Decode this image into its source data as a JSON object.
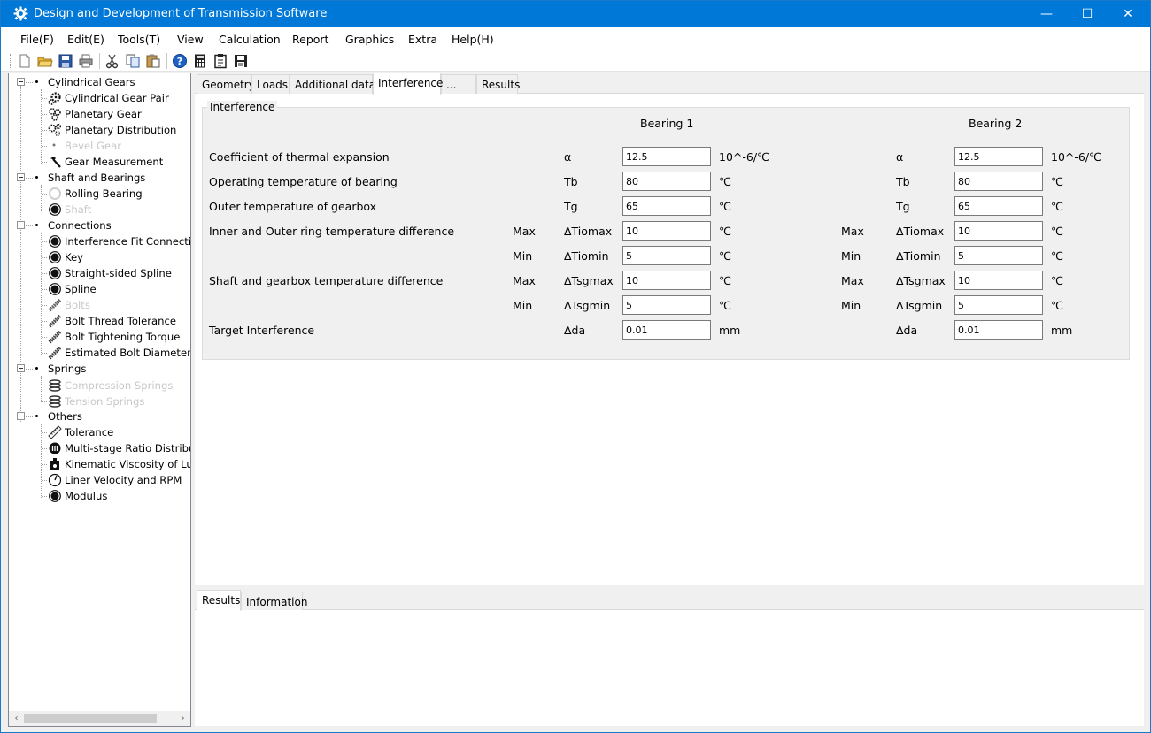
{
  "window": {
    "title": "Design and Development of Transmission Software",
    "minimize_glyph": "—",
    "maximize_glyph": "☐",
    "close_glyph": "✕",
    "app_icon": "gear-icon"
  },
  "menu": [
    {
      "label": "File(F)"
    },
    {
      "label": "Edit(E)"
    },
    {
      "label": "Tools(T)"
    },
    {
      "label": "View"
    },
    {
      "label": "Calculation"
    },
    {
      "label": "Report"
    },
    {
      "label": "Graphics"
    },
    {
      "label": "Extra"
    },
    {
      "label": "Help(H)"
    }
  ],
  "toolbar": [
    "new-file-icon",
    "open-folder-icon",
    "save-icon",
    "print-icon",
    "cut-icon",
    "copy-icon",
    "paste-icon",
    "help-icon",
    "calculator-icon",
    "clipboard-icon",
    "save-as-icon"
  ],
  "tree": {
    "groups": [
      {
        "label": "Cylindrical Gears",
        "children": [
          {
            "label": "Cylindrical Gear Pair",
            "icon": "gear-icon",
            "enabled": true
          },
          {
            "label": "Planetary Gear",
            "icon": "planetary-gear-icon",
            "enabled": true
          },
          {
            "label": "Planetary Distribution",
            "icon": "planetary-distribution-icon",
            "enabled": true
          },
          {
            "label": "Bevel Gear",
            "icon": "dot-icon",
            "enabled": false
          },
          {
            "label": "Gear Measurement",
            "icon": "hammer-icon",
            "enabled": true
          }
        ]
      },
      {
        "label": "Shaft and Bearings",
        "children": [
          {
            "label": "Rolling Bearing",
            "icon": "ring-icon",
            "enabled": true
          },
          {
            "label": "Shaft",
            "icon": "disc-icon",
            "enabled": false
          }
        ]
      },
      {
        "label": "Connections",
        "children": [
          {
            "label": "Interference Fit Connection",
            "icon": "disc-icon",
            "enabled": true
          },
          {
            "label": "Key",
            "icon": "disc-icon",
            "enabled": true
          },
          {
            "label": "Straight-sided Spline",
            "icon": "disc-icon",
            "enabled": true
          },
          {
            "label": "Spline",
            "icon": "disc-icon",
            "enabled": true
          },
          {
            "label": "Bolts",
            "icon": "bolt-icon",
            "enabled": false
          },
          {
            "label": "Bolt Thread Tolerance",
            "icon": "bolt-icon",
            "enabled": true
          },
          {
            "label": "Bolt Tightening Torque",
            "icon": "bolt-icon",
            "enabled": true
          },
          {
            "label": "Estimated Bolt Diameter",
            "icon": "bolt-icon",
            "enabled": true
          }
        ]
      },
      {
        "label": "Springs",
        "children": [
          {
            "label": "Compression Springs",
            "icon": "spring-icon",
            "enabled": false
          },
          {
            "label": "Tension Springs",
            "icon": "spring-icon",
            "enabled": false
          }
        ]
      },
      {
        "label": "Others",
        "children": [
          {
            "label": "Tolerance",
            "icon": "ruler-icon",
            "enabled": true
          },
          {
            "label": "Multi-stage Ratio Distributi",
            "icon": "ratio-icon",
            "enabled": true
          },
          {
            "label": "Kinematic Viscosity of Lubr",
            "icon": "oil-can-icon",
            "enabled": true
          },
          {
            "label": "Liner Velocity and RPM",
            "icon": "gauge-icon",
            "enabled": true
          },
          {
            "label": "Modulus",
            "icon": "disc-icon",
            "enabled": true
          }
        ]
      }
    ]
  },
  "tabs": [
    {
      "label": "Geometry"
    },
    {
      "label": "Loads"
    },
    {
      "label": "Additional data"
    },
    {
      "label": "Interference"
    },
    {
      "label": "..."
    },
    {
      "label": "Results"
    }
  ],
  "active_tab": "Interference",
  "interference": {
    "legend": "Interference",
    "bearing1_title": "Bearing 1",
    "bearing2_title": "Bearing 2",
    "rows": [
      {
        "label": "Coefficient of thermal expansion",
        "sub": "",
        "sym": "α",
        "b1": "12.5",
        "b2": "12.5",
        "unit": "10^-6/℃"
      },
      {
        "label": "Operating temperature of bearing",
        "sub": "",
        "sym": "Tb",
        "b1": "80",
        "b2": "80",
        "unit": "℃"
      },
      {
        "label": "Outer temperature of gearbox",
        "sub": "",
        "sym": "Tg",
        "b1": "65",
        "b2": "65",
        "unit": "℃"
      },
      {
        "label": "Inner and Outer ring temperature difference",
        "sub": "Max",
        "sym": "ΔTiomax",
        "b1": "10",
        "b2": "10",
        "unit": "℃"
      },
      {
        "label": "",
        "sub": "Min",
        "sym": "ΔTiomin",
        "b1": "5",
        "b2": "5",
        "unit": "℃"
      },
      {
        "label": "Shaft and gearbox temperature difference",
        "sub": "Max",
        "sym": "ΔTsgmax",
        "b1": "10",
        "b2": "10",
        "unit": "℃"
      },
      {
        "label": "",
        "sub": "Min",
        "sym": "ΔTsgmin",
        "b1": "5",
        "b2": "5",
        "unit": "℃"
      },
      {
        "label": "Target Interference",
        "sub": "",
        "sym": "Δda",
        "b1": "0.01",
        "b2": "0.01",
        "unit": "mm"
      }
    ]
  },
  "bottom_tabs": [
    {
      "label": "Results"
    },
    {
      "label": "Information"
    }
  ],
  "scrollbar": {
    "left_arrow": "‹",
    "right_arrow": "›"
  }
}
